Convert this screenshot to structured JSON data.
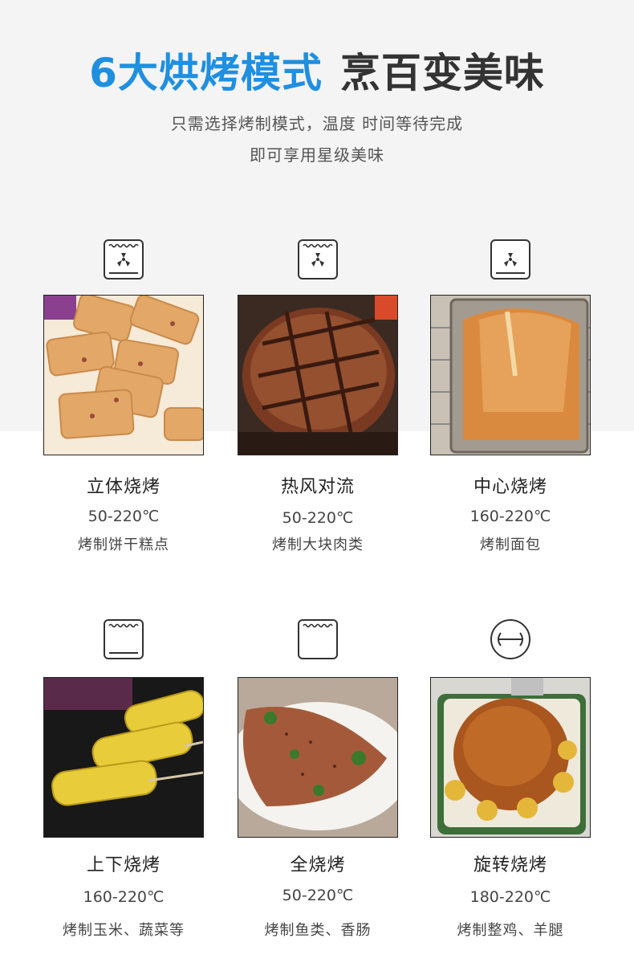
{
  "header": {
    "title_highlight": "6大烘烤模式",
    "title_rest": "烹百变美味",
    "subtitle_line1": "只需选择烤制模式，温度 时间等待完成",
    "subtitle_line2": "即可享用星级美味"
  },
  "modes": [
    {
      "name": "立体烧烤",
      "temp": "50-220℃",
      "usage": "烤制饼干糕点",
      "icon": "fan-top-bottom-heat-icon",
      "photo": "cookies-photo"
    },
    {
      "name": "热风对流",
      "temp": "50-220℃",
      "usage": "烤制大块肉类",
      "icon": "fan-top-heat-icon",
      "photo": "roast-beef-photo"
    },
    {
      "name": "中心烧烤",
      "temp": "160-220℃",
      "usage": "烤制面包",
      "icon": "fan-bottom-heat-icon",
      "photo": "bread-loaf-photo"
    },
    {
      "name": "上下烧烤",
      "temp": "160-220℃",
      "usage": "烤制玉米、蔬菜等",
      "icon": "top-bottom-heat-icon",
      "photo": "corn-photo"
    },
    {
      "name": "全烧烤",
      "temp": "50-220℃",
      "usage": "烤制鱼类、香肠",
      "icon": "top-heat-icon",
      "photo": "grilled-fish-photo"
    },
    {
      "name": "旋转烧烤",
      "temp": "180-220℃",
      "usage": "烤制整鸡、羊腿",
      "icon": "rotisserie-icon",
      "photo": "roast-chicken-photo"
    }
  ],
  "colors": {
    "accent": "#1f8fe0",
    "text": "#333333",
    "band": "#f4f4f4"
  }
}
